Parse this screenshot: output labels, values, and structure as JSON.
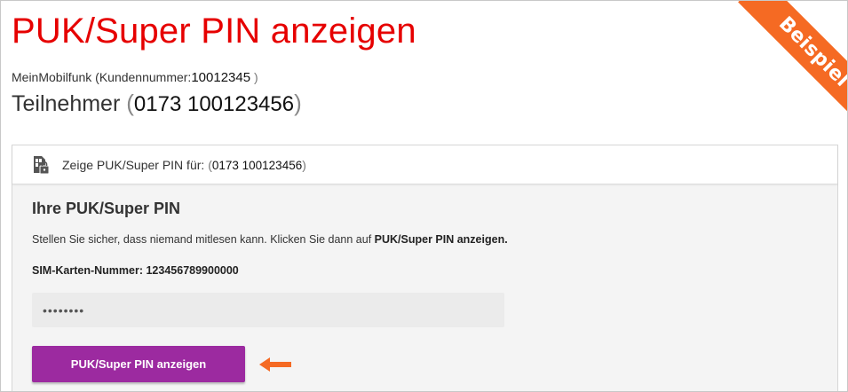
{
  "page": {
    "title": "PUK/Super PIN anzeigen"
  },
  "account": {
    "label": "MeinMobilfunk (Kundennummer:",
    "number": "10012345",
    "close": ")"
  },
  "subscriber": {
    "label": "Teilnehmer",
    "open": "(",
    "number": "0173 100123456",
    "close": ")"
  },
  "ribbon": {
    "label": "Beispiel",
    "color": "#f56a23"
  },
  "panel": {
    "header_label": "Zeige PUK/Super PIN für:",
    "header_open": "(",
    "header_number": "0173 100123456",
    "header_close": ")",
    "header_icon": "sim-lock-icon",
    "section_title": "Ihre PUK/Super PIN",
    "hint_text": "Stellen Sie sicher, dass niemand mitlesen kann. Klicken Sie dann auf ",
    "hint_bold": "PUK/Super PIN anzeigen.",
    "sim_label": "SIM-Karten-Nummer: 123456789900000",
    "pin_masked": "••••••••",
    "button_label": "PUK/Super PIN anzeigen",
    "button_color": "#9c2aa0",
    "arrow_icon": "arrow-left-icon",
    "arrow_color": "#f56a23"
  },
  "colors": {
    "title": "#e60000"
  }
}
